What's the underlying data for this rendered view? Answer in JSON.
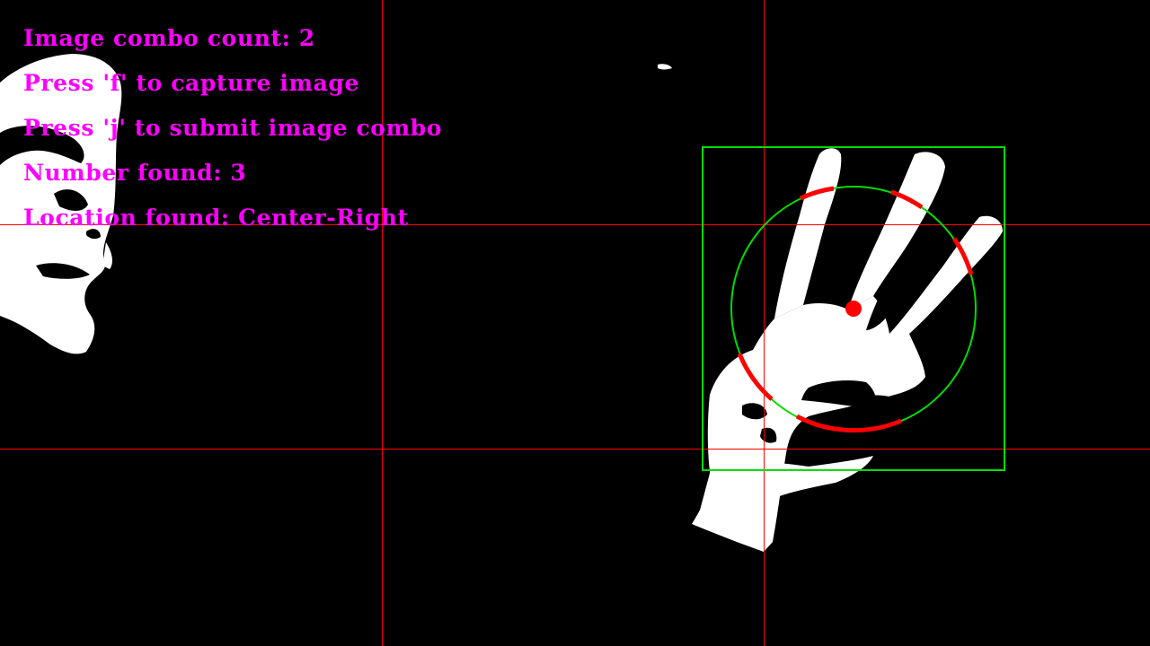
{
  "overlay": {
    "combo_count_text": "Image combo count: 2",
    "capture_hint_text": "Press 'f' to capture image",
    "submit_hint_text": "Press 'j' to submit image combo",
    "number_found_text": "Number found: 3",
    "location_found_text": "Location found: Center-Right"
  },
  "detection": {
    "fingers_detected": 3,
    "location": "Center-Right"
  },
  "colors": {
    "background": "#000000",
    "foreground_mask": "#ffffff",
    "hud_text": "#ff00ff",
    "grid_lines": "#ff0000",
    "bounding_box": "#00dd00",
    "palm_circle": "#00dd00",
    "finger_arcs": "#ff0000",
    "palm_center": "#ff0000"
  }
}
